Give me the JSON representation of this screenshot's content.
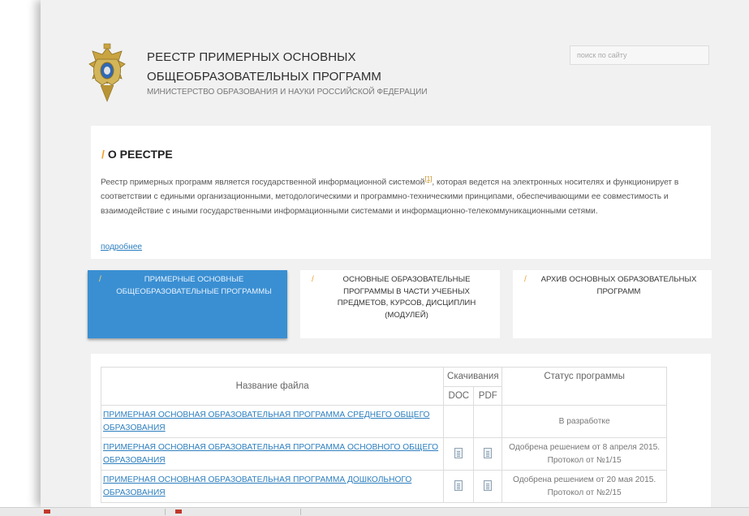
{
  "header": {
    "title_line1": "РЕЕСТР ПРИМЕРНЫХ ОСНОВНЫХ",
    "title_line2": "ОБЩЕОБРАЗОВАТЕЛЬНЫХ ПРОГРАММ",
    "subtitle": "МИНИСТЕРСТВО ОБРАЗОВАНИЯ И НАУКИ РОССИЙСКОЙ ФЕДЕРАЦИИ",
    "search_placeholder": "поиск по сайту"
  },
  "about": {
    "slash": "/",
    "title": "О РЕЕСТРЕ",
    "text_before": "Реестр примерных программ является государственной информационной системой",
    "footnote": "[1]",
    "text_after": ", которая ведется на электронных носителях и функционирует в соответствии с едиными организационными, методологическими и программно-техническими принципами, обеспечивающими ее совместимость и взаимодействие с иными государственными информационными системами и информационно-телекоммуникационными сетями.",
    "more_link": "подробнее"
  },
  "tabs": [
    {
      "slash": "/",
      "label": "ПРИМЕРНЫЕ ОСНОВНЫЕ ОБЩЕОБРАЗОВАТЕЛЬНЫЕ ПРОГРАММЫ",
      "active": true
    },
    {
      "slash": "/",
      "label": "ОСНОВНЫЕ ОБРАЗОВАТЕЛЬНЫЕ ПРОГРАММЫ В ЧАСТИ УЧЕБНЫХ ПРЕДМЕТОВ, КУРСОВ, ДИСЦИПЛИН (МОДУЛЕЙ)",
      "active": false
    },
    {
      "slash": "/",
      "label": "АРХИВ ОСНОВНЫХ ОБРАЗОВАТЕЛЬНЫХ ПРОГРАММ",
      "active": false
    }
  ],
  "table": {
    "col_name": "Название файла",
    "col_downloads": "Скачивания",
    "col_doc": "DOC",
    "col_pdf": "PDF",
    "col_status": "Статус программы",
    "rows": [
      {
        "name": "ПРИМЕРНАЯ ОСНОВНАЯ ОБРАЗОВАТЕЛЬНАЯ ПРОГРАММА СРЕДНЕГО ОБЩЕГО ОБРАЗОВАНИЯ",
        "status": "В разработке",
        "has_files": false
      },
      {
        "name": "ПРИМЕРНАЯ ОСНОВНАЯ ОБРАЗОВАТЕЛЬНАЯ ПРОГРАММА ОСНОВНОГО ОБЩЕГО ОБРАЗОВАНИЯ",
        "status": "Одобрена решением от 8 апреля 2015. Протокол от №1/15",
        "has_files": true
      },
      {
        "name": "ПРИМЕРНАЯ ОСНОВНАЯ ОБРАЗОВАТЕЛЬНАЯ ПРОГРАММА ДОШКОЛЬНОГО ОБРАЗОВАНИЯ",
        "status": "Одобрена решением от 20 мая 2015. Протокол от №2/15",
        "has_files": true
      }
    ]
  },
  "colors": {
    "accent": "#f0a02a",
    "active_tab": "#3a8fd2",
    "link": "#2d7fbf"
  }
}
